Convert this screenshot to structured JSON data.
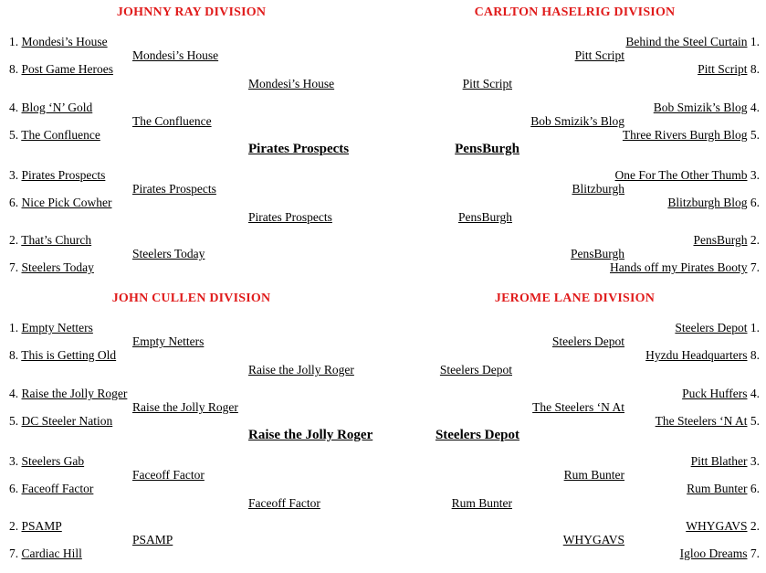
{
  "divisions": [
    {
      "id": "johnny-ray",
      "title": "JOHNNY RAY DIVISION",
      "side": "left",
      "champion": "Pirates Prospects",
      "round1": [
        {
          "seed": "1.",
          "name": "Mondesi’s House"
        },
        {
          "seed": "8.",
          "name": "Post Game Heroes"
        },
        {
          "seed": "4.",
          "name": "Blog ‘N’  Gold"
        },
        {
          "seed": "5.",
          "name": "The Confluence"
        },
        {
          "seed": "3.",
          "name": "Pirates Prospects"
        },
        {
          "seed": "6.",
          "name": "Nice Pick  Cowher"
        },
        {
          "seed": "2.",
          "name": "That’s Church"
        },
        {
          "seed": "7.",
          "name": "Steelers Today"
        }
      ],
      "round2": [
        "Mondesi’s House",
        "The Confluence",
        "Pirates Prospects",
        "Steelers Today"
      ],
      "round3": [
        "Mondesi’s House",
        "Pirates Prospects"
      ]
    },
    {
      "id": "carlton-haselrig",
      "title": "CARLTON HASELRIG  DIVISION",
      "side": "right",
      "champion": "PensBurgh",
      "round1": [
        {
          "seed": "1.",
          "name": "Behind the Steel Curtain"
        },
        {
          "seed": "8.",
          "name": "Pitt  Script"
        },
        {
          "seed": "4.",
          "name": "Bob Smizik’s Blog"
        },
        {
          "seed": "5.",
          "name": "Three Rivers Burgh Blog"
        },
        {
          "seed": "3.",
          "name": "One For The Other Thumb"
        },
        {
          "seed": "6.",
          "name": "Blitzburgh Blog"
        },
        {
          "seed": "2.",
          "name": "PensBurgh"
        },
        {
          "seed": "7.",
          "name": "Hands off my Pirates Booty"
        }
      ],
      "round2": [
        "Pitt Script",
        "Bob Smizik’s Blog",
        "Blitzburgh",
        "PensBurgh"
      ],
      "round3": [
        "Pitt Script",
        "PensBurgh"
      ]
    },
    {
      "id": "john-cullen",
      "title": "JOHN CULLEN  DIVISION",
      "side": "left",
      "champion": "Raise the Jolly Roger",
      "round1": [
        {
          "seed": "1.",
          "name": "Empty Netters"
        },
        {
          "seed": "8.",
          "name": "This is Getting Old"
        },
        {
          "seed": "4.",
          "name": "Raise the Jolly Roger"
        },
        {
          "seed": "5.",
          "name": "DC Steeler Nation"
        },
        {
          "seed": "3.",
          "name": "Steelers Gab"
        },
        {
          "seed": "6.",
          "name": "Faceoff Factor"
        },
        {
          "seed": "2.",
          "name": "PSAMP"
        },
        {
          "seed": "7.",
          "name": "Cardiac Hill"
        }
      ],
      "round2": [
        "Empty Netters",
        "Raise the Jolly Roger",
        "Faceoff Factor",
        "PSAMP"
      ],
      "round3": [
        "Raise the Jolly Roger",
        "Faceoff Factor"
      ]
    },
    {
      "id": "jerome-lane",
      "title": "JEROME LANE DIVISION",
      "side": "right",
      "champion": "Steelers Depot",
      "round1": [
        {
          "seed": "1.",
          "name": "Steelers Depot"
        },
        {
          "seed": "8.",
          "name": "Hyzdu Headquarters"
        },
        {
          "seed": "4.",
          "name": "Puck Huffers"
        },
        {
          "seed": "5.",
          "name": "The Steelers ‘N At"
        },
        {
          "seed": "3.",
          "name": "Pitt Blather"
        },
        {
          "seed": "6.",
          "name": "Rum Bunter"
        },
        {
          "seed": "2.",
          "name": "WHYGAVS"
        },
        {
          "seed": "7.",
          "name": "Igloo Dreams"
        }
      ],
      "round2": [
        "Steelers Depot",
        "The Steelers ‘N At",
        "Rum Bunter",
        "WHYGAVS"
      ],
      "round3": [
        "Steelers Depot",
        "Rum Bunter"
      ]
    }
  ]
}
